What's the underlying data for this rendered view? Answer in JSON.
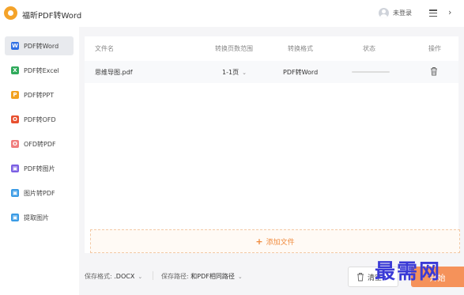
{
  "app": {
    "title": "福昕PDF转Word",
    "login_label": "未登录"
  },
  "colors": {
    "accent": "#f08a3c",
    "logo": "#f4a32a",
    "watermark": "#3a3ad6"
  },
  "sidebar": {
    "items": [
      {
        "label": "PDF转Word",
        "icon": "W",
        "color": "#2f6fe4",
        "active": true
      },
      {
        "label": "PDF转Excel",
        "icon": "X",
        "color": "#2faa5b",
        "active": false
      },
      {
        "label": "PDF转PPT",
        "icon": "P",
        "color": "#f2a11f",
        "active": false
      },
      {
        "label": "PDF转OFD",
        "icon": "O",
        "color": "#e8502f",
        "active": false
      },
      {
        "label": "OFD转PDF",
        "icon": "O",
        "color": "#f07d7d",
        "active": false
      },
      {
        "label": "PDF转图片",
        "icon": "▣",
        "color": "#7b5fe3",
        "active": false
      },
      {
        "label": "图片转PDF",
        "icon": "▣",
        "color": "#3a9be5",
        "active": false
      },
      {
        "label": "提取图片",
        "icon": "▣",
        "color": "#3a9be5",
        "active": false
      }
    ]
  },
  "table": {
    "headers": {
      "name": "文件名",
      "range": "转换页数范围",
      "format": "转换格式",
      "status": "状态",
      "action": "操作"
    },
    "rows": [
      {
        "name": "思维导图.pdf",
        "range": "1-1页",
        "format": "PDF转Word",
        "progress": 0
      }
    ]
  },
  "add_file_label": "添加文件",
  "footer": {
    "format_label": "保存格式:",
    "format_value": ".DOCX",
    "path_label": "保存路径:",
    "path_value": "和PDF相同路径",
    "clear_label": "清空",
    "start_label": "开始"
  },
  "watermark": "最需网"
}
